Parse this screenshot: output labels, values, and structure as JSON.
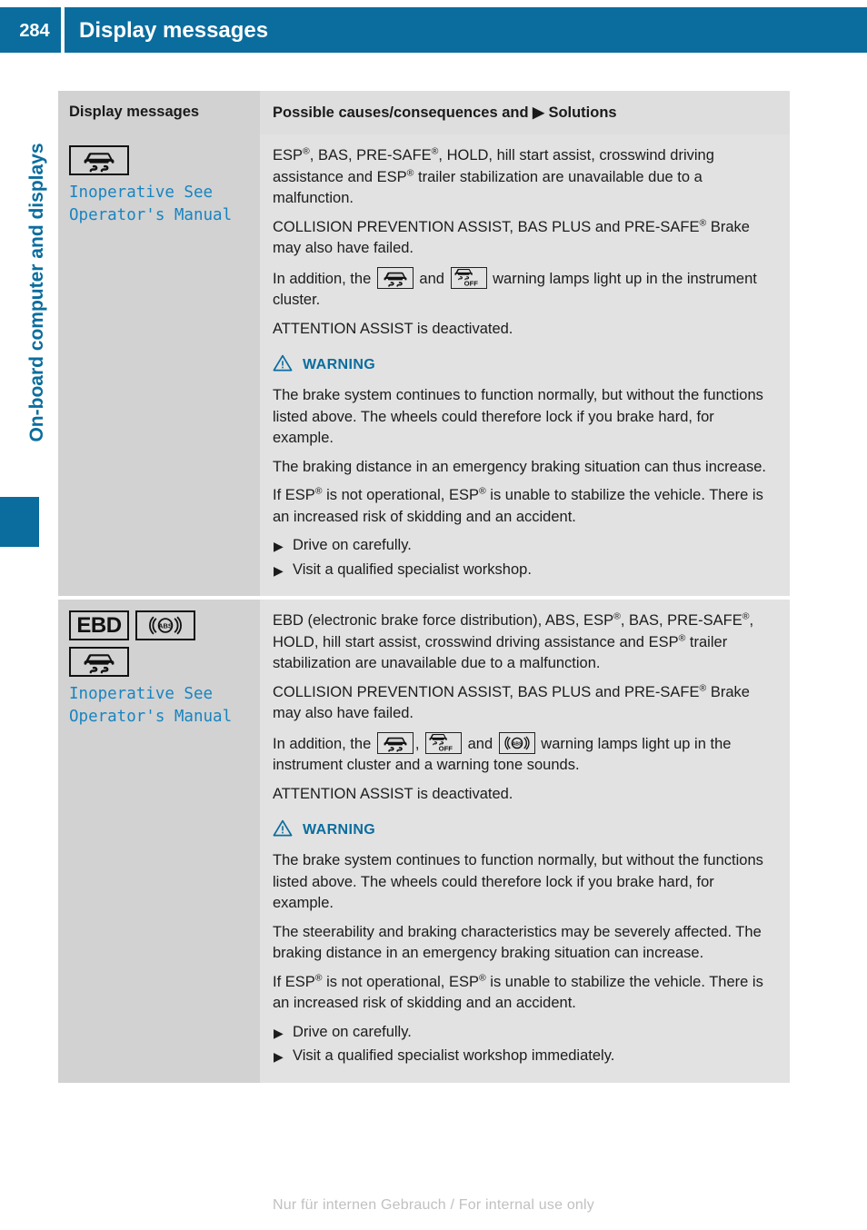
{
  "header": {
    "page_number": "284",
    "title": "Display messages",
    "accent_color": "#0a6d9e"
  },
  "side": {
    "chapter_label": "On-board computer and displays"
  },
  "table": {
    "columns": [
      {
        "label": "Display messages"
      },
      {
        "label_pre": "Possible causes/consequences and",
        "arrow": "▶",
        "label_post": "Solutions"
      }
    ],
    "rows": [
      {
        "icons": [
          "esp-car-skid-icon"
        ],
        "message": "Inoperative See\nOperator's Manual",
        "blocks": [
          {
            "type": "para",
            "segments": [
              {
                "t": "ESP"
              },
              {
                "t": "®",
                "sup": true
              },
              {
                "t": ", BAS, PRE-SAFE"
              },
              {
                "t": "®",
                "sup": true
              },
              {
                "t": ", HOLD, hill start assist, crosswind driving assistance and ESP"
              },
              {
                "t": "®",
                "sup": true
              },
              {
                "t": " trailer stabilization are unavailable due to a malfunction."
              }
            ]
          },
          {
            "type": "para",
            "segments": [
              {
                "t": "COLLISION PREVENTION ASSIST, BAS PLUS and PRE-SAFE"
              },
              {
                "t": "®",
                "sup": true
              },
              {
                "t": " Brake may also have failed."
              }
            ]
          },
          {
            "type": "para",
            "segments": [
              {
                "t": "In addition, the "
              },
              {
                "icon": "esp-car-skid-icon"
              },
              {
                "t": " and "
              },
              {
                "icon": "esp-off-icon"
              },
              {
                "t": " warning lamps light up in the instrument cluster."
              }
            ]
          },
          {
            "type": "para",
            "segments": [
              {
                "t": "ATTENTION ASSIST is deactivated."
              }
            ]
          },
          {
            "type": "warning",
            "label": "WARNING"
          },
          {
            "type": "para",
            "segments": [
              {
                "t": "The brake system continues to function normally, but without the functions listed above. The wheels could therefore lock if you brake hard, for example."
              }
            ]
          },
          {
            "type": "para",
            "segments": [
              {
                "t": "The braking distance in an emergency braking situation can thus increase."
              }
            ]
          },
          {
            "type": "para",
            "segments": [
              {
                "t": "If ESP"
              },
              {
                "t": "®",
                "sup": true
              },
              {
                "t": " is not operational, ESP"
              },
              {
                "t": "®",
                "sup": true
              },
              {
                "t": " is unable to stabilize the vehicle. There is an increased risk of skidding and an accident."
              }
            ]
          },
          {
            "type": "step",
            "segments": [
              {
                "t": "Drive on carefully."
              }
            ]
          },
          {
            "type": "step",
            "segments": [
              {
                "t": "Visit a qualified specialist workshop."
              }
            ]
          }
        ]
      },
      {
        "icons": [
          "ebd-text-icon",
          "abs-icon",
          "esp-car-skid-icon"
        ],
        "message": "Inoperative See\nOperator's Manual",
        "blocks": [
          {
            "type": "para",
            "segments": [
              {
                "t": "EBD (electronic brake force distribution), ABS, ESP"
              },
              {
                "t": "®",
                "sup": true
              },
              {
                "t": ", BAS, PRE-SAFE"
              },
              {
                "t": "®",
                "sup": true
              },
              {
                "t": ", HOLD, hill start assist, crosswind driving assistance and ESP"
              },
              {
                "t": "®",
                "sup": true
              },
              {
                "t": " trailer stabilization are unavailable due to a malfunction."
              }
            ]
          },
          {
            "type": "para",
            "segments": [
              {
                "t": "COLLISION PREVENTION ASSIST, BAS PLUS and PRE-SAFE"
              },
              {
                "t": "®",
                "sup": true
              },
              {
                "t": " Brake may also have failed."
              }
            ]
          },
          {
            "type": "para",
            "segments": [
              {
                "t": "In addition, the "
              },
              {
                "icon": "esp-car-skid-icon"
              },
              {
                "t": ", "
              },
              {
                "icon": "esp-off-icon"
              },
              {
                "t": " and "
              },
              {
                "icon": "abs-icon"
              },
              {
                "t": " warning lamps light up in the instrument cluster and a warning tone sounds."
              }
            ]
          },
          {
            "type": "para",
            "segments": [
              {
                "t": "ATTENTION ASSIST is deactivated."
              }
            ]
          },
          {
            "type": "warning",
            "label": "WARNING"
          },
          {
            "type": "para",
            "segments": [
              {
                "t": "The brake system continues to function normally, but without the functions listed above. The wheels could therefore lock if you brake hard, for example."
              }
            ]
          },
          {
            "type": "para",
            "segments": [
              {
                "t": "The steerability and braking characteristics may be severely affected. The braking distance in an emergency braking situation can increase."
              }
            ]
          },
          {
            "type": "para",
            "segments": [
              {
                "t": "If ESP"
              },
              {
                "t": "®",
                "sup": true
              },
              {
                "t": " is not operational, ESP"
              },
              {
                "t": "®",
                "sup": true
              },
              {
                "t": " is unable to stabilize the vehicle. There is an increased risk of skidding and an accident."
              }
            ]
          },
          {
            "type": "step",
            "segments": [
              {
                "t": "Drive on carefully."
              }
            ]
          },
          {
            "type": "step",
            "segments": [
              {
                "t": "Visit a qualified specialist workshop immediately."
              }
            ]
          }
        ]
      }
    ]
  },
  "footer": {
    "watermark": "Nur für internen Gebrauch / For internal use only"
  },
  "icon_labels": {
    "ebd-text-icon": "EBD",
    "abs-icon": "ABS"
  }
}
